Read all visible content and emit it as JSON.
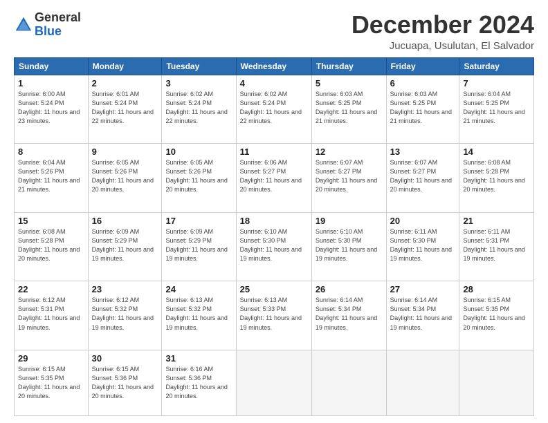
{
  "header": {
    "logo_line1": "General",
    "logo_line2": "Blue",
    "month": "December 2024",
    "location": "Jucuapa, Usulutan, El Salvador"
  },
  "weekdays": [
    "Sunday",
    "Monday",
    "Tuesday",
    "Wednesday",
    "Thursday",
    "Friday",
    "Saturday"
  ],
  "weeks": [
    [
      {
        "day": "1",
        "sunrise": "6:00 AM",
        "sunset": "5:24 PM",
        "daylight": "11 hours and 23 minutes."
      },
      {
        "day": "2",
        "sunrise": "6:01 AM",
        "sunset": "5:24 PM",
        "daylight": "11 hours and 22 minutes."
      },
      {
        "day": "3",
        "sunrise": "6:02 AM",
        "sunset": "5:24 PM",
        "daylight": "11 hours and 22 minutes."
      },
      {
        "day": "4",
        "sunrise": "6:02 AM",
        "sunset": "5:24 PM",
        "daylight": "11 hours and 22 minutes."
      },
      {
        "day": "5",
        "sunrise": "6:03 AM",
        "sunset": "5:25 PM",
        "daylight": "11 hours and 21 minutes."
      },
      {
        "day": "6",
        "sunrise": "6:03 AM",
        "sunset": "5:25 PM",
        "daylight": "11 hours and 21 minutes."
      },
      {
        "day": "7",
        "sunrise": "6:04 AM",
        "sunset": "5:25 PM",
        "daylight": "11 hours and 21 minutes."
      }
    ],
    [
      {
        "day": "8",
        "sunrise": "6:04 AM",
        "sunset": "5:26 PM",
        "daylight": "11 hours and 21 minutes."
      },
      {
        "day": "9",
        "sunrise": "6:05 AM",
        "sunset": "5:26 PM",
        "daylight": "11 hours and 20 minutes."
      },
      {
        "day": "10",
        "sunrise": "6:05 AM",
        "sunset": "5:26 PM",
        "daylight": "11 hours and 20 minutes."
      },
      {
        "day": "11",
        "sunrise": "6:06 AM",
        "sunset": "5:27 PM",
        "daylight": "11 hours and 20 minutes."
      },
      {
        "day": "12",
        "sunrise": "6:07 AM",
        "sunset": "5:27 PM",
        "daylight": "11 hours and 20 minutes."
      },
      {
        "day": "13",
        "sunrise": "6:07 AM",
        "sunset": "5:27 PM",
        "daylight": "11 hours and 20 minutes."
      },
      {
        "day": "14",
        "sunrise": "6:08 AM",
        "sunset": "5:28 PM",
        "daylight": "11 hours and 20 minutes."
      }
    ],
    [
      {
        "day": "15",
        "sunrise": "6:08 AM",
        "sunset": "5:28 PM",
        "daylight": "11 hours and 20 minutes."
      },
      {
        "day": "16",
        "sunrise": "6:09 AM",
        "sunset": "5:29 PM",
        "daylight": "11 hours and 19 minutes."
      },
      {
        "day": "17",
        "sunrise": "6:09 AM",
        "sunset": "5:29 PM",
        "daylight": "11 hours and 19 minutes."
      },
      {
        "day": "18",
        "sunrise": "6:10 AM",
        "sunset": "5:30 PM",
        "daylight": "11 hours and 19 minutes."
      },
      {
        "day": "19",
        "sunrise": "6:10 AM",
        "sunset": "5:30 PM",
        "daylight": "11 hours and 19 minutes."
      },
      {
        "day": "20",
        "sunrise": "6:11 AM",
        "sunset": "5:30 PM",
        "daylight": "11 hours and 19 minutes."
      },
      {
        "day": "21",
        "sunrise": "6:11 AM",
        "sunset": "5:31 PM",
        "daylight": "11 hours and 19 minutes."
      }
    ],
    [
      {
        "day": "22",
        "sunrise": "6:12 AM",
        "sunset": "5:31 PM",
        "daylight": "11 hours and 19 minutes."
      },
      {
        "day": "23",
        "sunrise": "6:12 AM",
        "sunset": "5:32 PM",
        "daylight": "11 hours and 19 minutes."
      },
      {
        "day": "24",
        "sunrise": "6:13 AM",
        "sunset": "5:32 PM",
        "daylight": "11 hours and 19 minutes."
      },
      {
        "day": "25",
        "sunrise": "6:13 AM",
        "sunset": "5:33 PM",
        "daylight": "11 hours and 19 minutes."
      },
      {
        "day": "26",
        "sunrise": "6:14 AM",
        "sunset": "5:34 PM",
        "daylight": "11 hours and 19 minutes."
      },
      {
        "day": "27",
        "sunrise": "6:14 AM",
        "sunset": "5:34 PM",
        "daylight": "11 hours and 19 minutes."
      },
      {
        "day": "28",
        "sunrise": "6:15 AM",
        "sunset": "5:35 PM",
        "daylight": "11 hours and 20 minutes."
      }
    ],
    [
      {
        "day": "29",
        "sunrise": "6:15 AM",
        "sunset": "5:35 PM",
        "daylight": "11 hours and 20 minutes."
      },
      {
        "day": "30",
        "sunrise": "6:15 AM",
        "sunset": "5:36 PM",
        "daylight": "11 hours and 20 minutes."
      },
      {
        "day": "31",
        "sunrise": "6:16 AM",
        "sunset": "5:36 PM",
        "daylight": "11 hours and 20 minutes."
      },
      null,
      null,
      null,
      null
    ]
  ]
}
